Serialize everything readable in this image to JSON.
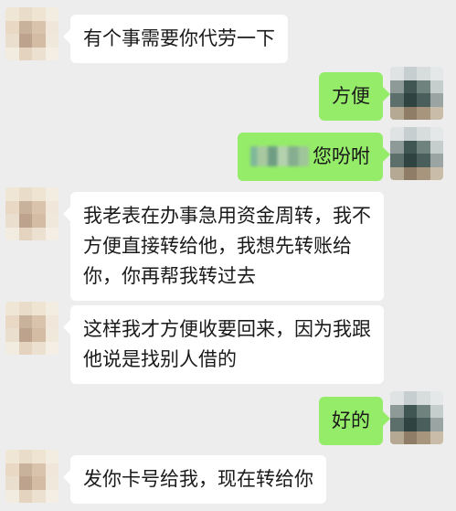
{
  "messages": [
    {
      "side": "left",
      "text": "有个事需要你代劳一下"
    },
    {
      "side": "right",
      "text": "方便"
    },
    {
      "side": "right",
      "text": "您吩咐",
      "redacted_prefix": true
    },
    {
      "side": "left",
      "lines": [
        "我老表在办事急用资金周转，我不",
        "方便直接转给他，我想先转账给",
        "你，你再帮我转过去"
      ]
    },
    {
      "side": "left",
      "lines": [
        "这样我才方便收要回来，因为我跟",
        "他说是找别人借的"
      ]
    },
    {
      "side": "right",
      "text": "好的"
    },
    {
      "side": "left",
      "text": "发你卡号给我，现在转给你"
    }
  ],
  "colors": {
    "background": "#ededed",
    "incoming_bubble": "#ffffff",
    "outgoing_bubble": "#95ec69"
  },
  "icons": {
    "contact_avatar": "pixelated-avatar-icon",
    "self_avatar": "pixelated-avatar-icon"
  }
}
